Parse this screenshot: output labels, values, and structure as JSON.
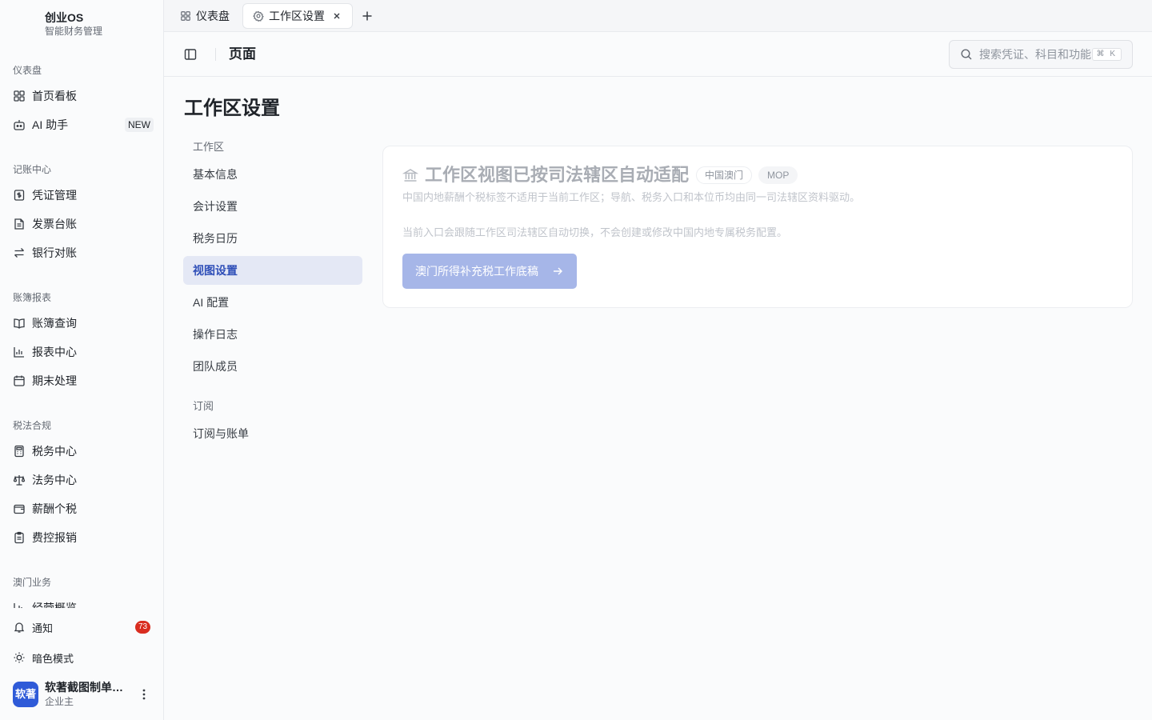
{
  "app": {
    "name": "创业OS",
    "subtitle": "智能财务管理"
  },
  "sidebar": {
    "groups": [
      {
        "label": "仪表盘",
        "items": [
          {
            "label": "首页看板",
            "icon": "layout-grid-icon"
          },
          {
            "label": "AI 助手",
            "icon": "bot-icon",
            "badge": "NEW"
          }
        ]
      },
      {
        "label": "记账中心",
        "items": [
          {
            "label": "凭证管理",
            "icon": "receipt-icon"
          },
          {
            "label": "发票台账",
            "icon": "file-text-icon"
          },
          {
            "label": "银行对账",
            "icon": "arrows-exchange-icon"
          }
        ]
      },
      {
        "label": "账簿报表",
        "items": [
          {
            "label": "账簿查询",
            "icon": "book-open-icon"
          },
          {
            "label": "报表中心",
            "icon": "bar-chart-icon"
          },
          {
            "label": "期末处理",
            "icon": "calendar-icon"
          }
        ]
      },
      {
        "label": "税法合规",
        "items": [
          {
            "label": "税务中心",
            "icon": "calculator-icon"
          },
          {
            "label": "法务中心",
            "icon": "scale-icon"
          },
          {
            "label": "薪酬个税",
            "icon": "wallet-icon"
          },
          {
            "label": "费控报销",
            "icon": "clipboard-icon"
          }
        ]
      },
      {
        "label": "澳门业务",
        "items": [
          {
            "label": "经营概览",
            "icon": "bar-chart-icon"
          }
        ]
      }
    ],
    "notifications": {
      "label": "通知",
      "count": "73"
    },
    "dark_mode": {
      "label": "暗色模式"
    },
    "user": {
      "avatar": "软著",
      "name": "软著截图制单账户",
      "role": "企业主"
    }
  },
  "tabs": [
    {
      "label": "仪表盘",
      "active": false
    },
    {
      "label": "工作区设置",
      "active": true
    }
  ],
  "header": {
    "crumb": "页面",
    "search_placeholder": "搜索凭证、科目和功能",
    "search_shortcut": "⌘ K"
  },
  "main": {
    "title": "工作区设置",
    "subnav": [
      {
        "label": "工作区",
        "items": [
          "基本信息",
          "会计设置",
          "税务日历",
          "视图设置",
          "AI 配置",
          "操作日志",
          "团队成员"
        ]
      },
      {
        "label": "订阅",
        "items": [
          "订阅与账单"
        ]
      }
    ],
    "active_item": "视图设置",
    "card": {
      "title": "工作区视图已按司法辖区自动适配",
      "tags": [
        "中国澳门",
        "MOP"
      ],
      "description": "中国内地薪酬个税标签不适用于当前工作区；导航、税务入口和本位币均由同一司法辖区资料驱动。",
      "note": "当前入口会跟随工作区司法辖区自动切换，不会创建或修改中国内地专属税务配置。",
      "button": "澳门所得补充税工作底稿"
    }
  },
  "colors": {
    "accent": "#2f4fb8",
    "active_bg": "#e4e8f5",
    "button_disabled": "#a6b6e8",
    "notification": "#d92d20",
    "avatar": "#2f5bd8"
  }
}
